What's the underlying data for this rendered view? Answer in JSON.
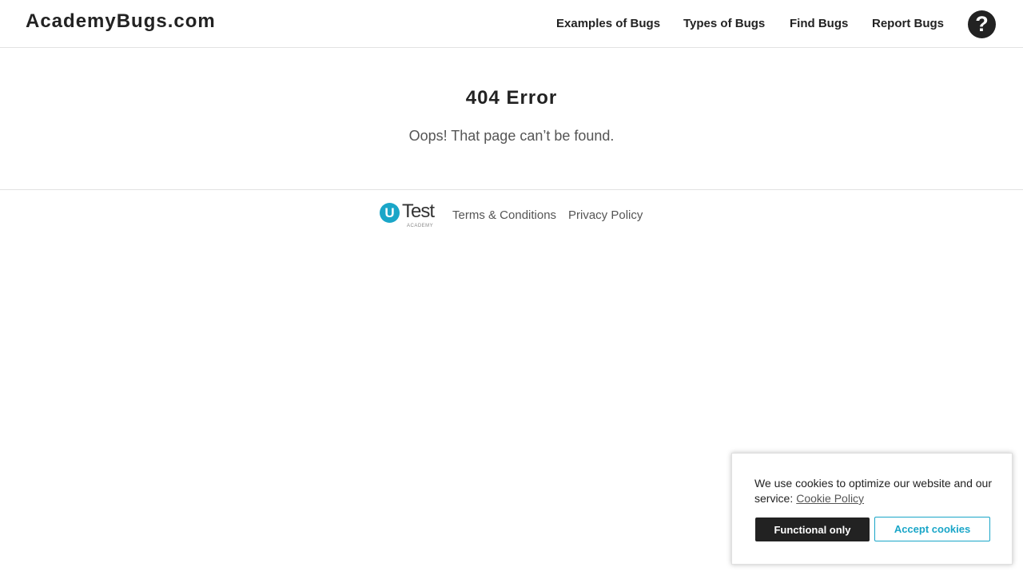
{
  "header": {
    "site_title": "AcademyBugs.com",
    "nav": [
      {
        "label": "Examples of Bugs"
      },
      {
        "label": "Types of Bugs"
      },
      {
        "label": "Find Bugs"
      },
      {
        "label": "Report Bugs"
      }
    ],
    "help_icon": "question-circle-icon",
    "help_glyph": "?"
  },
  "main": {
    "title": "404 Error",
    "message": "Oops! That page can’t be found."
  },
  "footer": {
    "logo": {
      "badge": "U",
      "word": "Test",
      "sub": "ACADEMY",
      "color": "#1aa6c8"
    },
    "links": [
      {
        "label": "Terms & Conditions"
      },
      {
        "label": "Privacy Policy"
      }
    ]
  },
  "cookie_banner": {
    "text": "We use cookies to optimize our website and our service:",
    "policy_link": "Cookie Policy",
    "functional_button": "Functional only",
    "accept_button": "Accept cookies",
    "accent_color": "#1aa6c8"
  }
}
